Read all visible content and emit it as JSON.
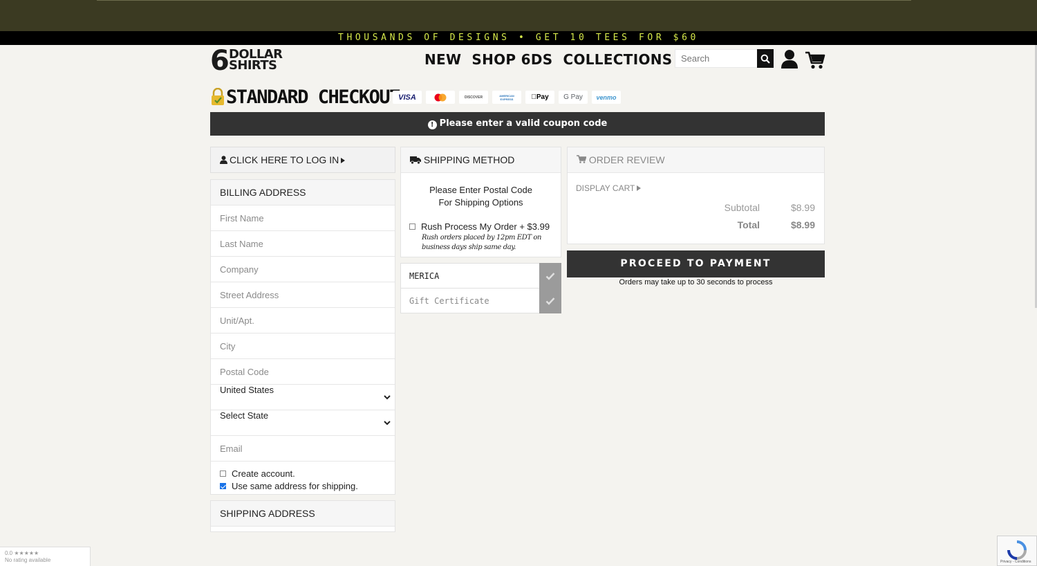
{
  "promo_banner": "THOUSANDS OF DESIGNS • GET 10 TEES FOR $60",
  "logo": {
    "number": "6",
    "line1": "DOLLAR",
    "line2": "SHIRTS"
  },
  "nav": [
    "NEW",
    "SHOP 6DS",
    "COLLECTIONS"
  ],
  "search": {
    "placeholder": "Search"
  },
  "checkout_title": "STANDARD CHECKOUT",
  "payment_methods": [
    {
      "name": "VISA",
      "color": "#1a1f71"
    },
    {
      "name": "mastercard",
      "color": "#eb001b"
    },
    {
      "name": "DISCOVER",
      "color": "#555555"
    },
    {
      "name": "AMERICAN EXPRESS",
      "color": "#2e77bb"
    },
    {
      "name": "Pay",
      "color": "#000000"
    },
    {
      "name": "G Pay",
      "color": "#5f6368"
    },
    {
      "name": "venmo",
      "color": "#3d95ce"
    }
  ],
  "alert": {
    "icon": "exclamation-circle-icon",
    "text": "Please enter a valid coupon code"
  },
  "login": {
    "label": "CLICK HERE TO LOG IN"
  },
  "billing": {
    "title": "BILLING ADDRESS",
    "fields": {
      "first_name": "First Name",
      "last_name": "Last Name",
      "company": "Company",
      "street": "Street Address",
      "unit": "Unit/Apt.",
      "city": "City",
      "postal": "Postal Code",
      "email": "Email"
    },
    "country": "United States",
    "state": "Select State",
    "create_account": "Create account.",
    "same_address": "Use same address for shipping."
  },
  "shipping_address": {
    "title": "SHIPPING ADDRESS"
  },
  "shipping_method": {
    "title": "SHIPPING METHOD",
    "msg_line1": "Please Enter Postal Code",
    "msg_line2": "For Shipping Options",
    "rush_label": "Rush Process My Order + $3.99",
    "rush_note_line1": "Rush orders placed by 12pm EDT on",
    "rush_note_line2": "business days ship same day."
  },
  "coupon": {
    "value": "MERICA"
  },
  "gift": {
    "placeholder": "Gift Certificate"
  },
  "order_review": {
    "title": "ORDER REVIEW",
    "display_cart": "DISPLAY CART",
    "subtotal_label": "Subtotal",
    "subtotal": "$8.99",
    "total_label": "Total",
    "total": "$8.99"
  },
  "proceed": {
    "label": "PROCEED TO PAYMENT",
    "note": "Orders may take up to 30 seconds to process"
  },
  "rating_widget": {
    "score": "0.0 ★★★★★",
    "text": "No rating available"
  },
  "recaptcha": {
    "text": "Privacy - Conditions"
  }
}
